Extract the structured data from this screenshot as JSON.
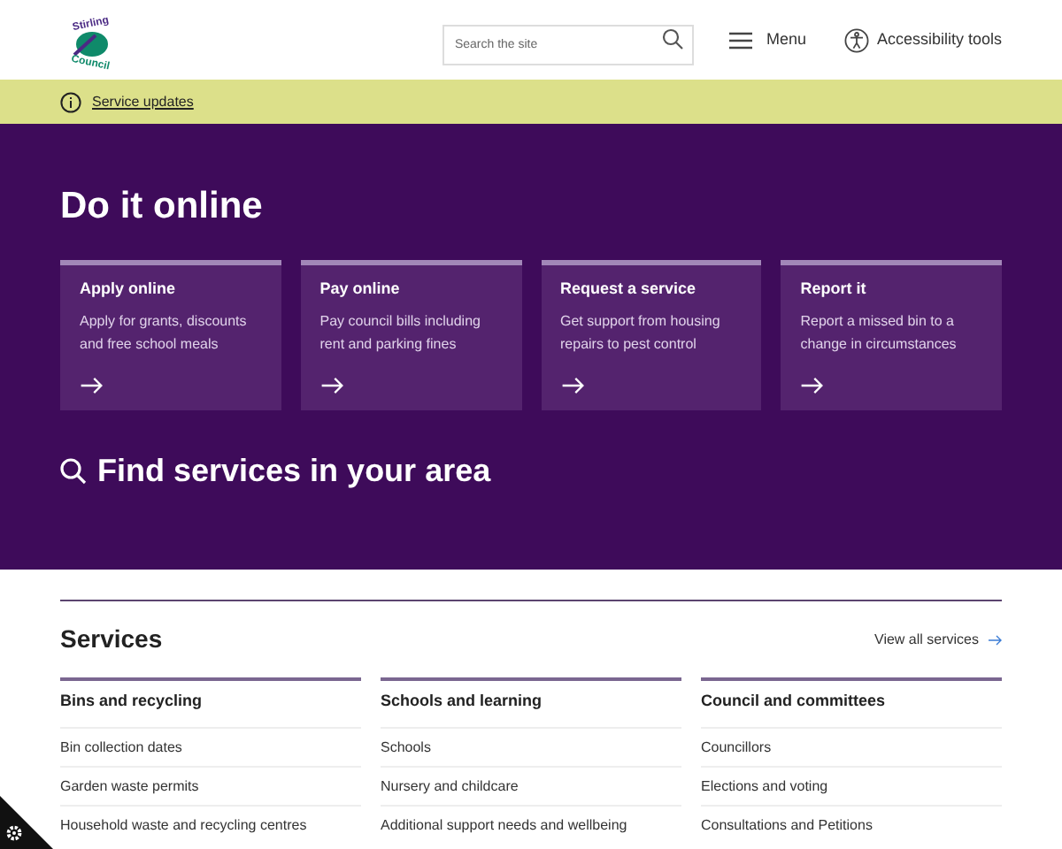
{
  "header": {
    "logo_text": [
      "Stirling",
      "Council"
    ],
    "search": {
      "placeholder": "Search the site"
    },
    "menu": "Menu",
    "accessibility": "Accessibility tools"
  },
  "alert": {
    "link": "Service updates"
  },
  "hero": {
    "title": "Do it online",
    "cards": [
      {
        "title": "Apply online",
        "text": "Apply for grants, discounts and free school meals"
      },
      {
        "title": "Pay online",
        "text": "Pay council bills including rent and parking fines"
      },
      {
        "title": "Request a service",
        "text": "Get support from housing repairs to pest control"
      },
      {
        "title": "Report it",
        "text": "Report a missed bin to a change in circumstances"
      }
    ],
    "find": "Find services in your area"
  },
  "services": {
    "title": "Services",
    "view_all": "View all services",
    "columns": [
      {
        "heading": "Bins and recycling",
        "links": [
          "Bin collection dates",
          "Garden waste permits",
          "Household waste and recycling centres"
        ]
      },
      {
        "heading": "Schools and learning",
        "links": [
          "Schools",
          "Nursery and childcare",
          "Additional support needs and wellbeing"
        ]
      },
      {
        "heading": "Council and committees",
        "links": [
          "Councillors",
          "Elections and voting",
          "Consultations and Petitions"
        ]
      }
    ]
  }
}
